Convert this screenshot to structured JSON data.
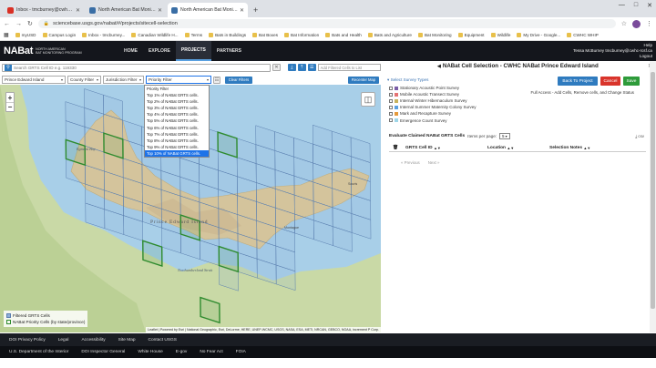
{
  "browser": {
    "tabs": [
      {
        "label": "Inbox - tmcburney@cwhc-rcsf.ca",
        "active": false,
        "color": "#d93025"
      },
      {
        "label": "North American Bat Monitoring",
        "active": false,
        "color": "#3a6ea5"
      },
      {
        "label": "North American Bat Monitoring",
        "active": true,
        "color": "#3a6ea5"
      }
    ],
    "new_tab": "+",
    "url": "sciencebase.usgs.gov/nabat/#/projects/sitecell-selection",
    "bookmarks": [
      "myUSD",
      "Campus Login",
      "Inbox - tmcburney...",
      "Canadian Wildlife H...",
      "Terms",
      "Bats in Buildings",
      "Bat Boxes",
      "Bat Information",
      "Bats and Health",
      "Bats and Agriculture",
      "Bat Monitoring",
      "Equipment",
      "Wildlife",
      "My Drive - Google...",
      "CWHC WHIP"
    ]
  },
  "app": {
    "logo": "NABat",
    "logo_sub_1": "North American",
    "logo_sub_2": "Bat Monitoring Program",
    "nav": [
      "HOME",
      "EXPLORE",
      "PROJECTS",
      "PARTNERS"
    ],
    "active_nav": "PROJECTS",
    "help": "Help",
    "user": "Tessa McBurney tmcburney@cwhc-rcsf.ca",
    "logout": "Logout"
  },
  "tools": {
    "search_placeholder": "Search GRTS Cell ID e.g. 119330",
    "add_cells_placeholder": "Add Filtered Cells to List",
    "province": "Prince Edward Island",
    "county": "County Filter",
    "jurisdiction": "Jurisdiction Filter",
    "priority": "Priority Filter",
    "clear_btn": "Clear Filters",
    "recenter_btn": "Recenter Map",
    "priority_options": [
      "Priority Filter",
      "Top 1% of NABat GRTS cells.",
      "Top 2% of NABat GRTS cells.",
      "Top 3% of NABat GRTS cells.",
      "Top 4% of NABat GRTS cells.",
      "Top 5% of NABat GRTS cells.",
      "Top 6% of NABat GRTS cells.",
      "Top 7% of NABat GRTS cells.",
      "Top 8% of NABat GRTS cells.",
      "Top 9% of NABat GRTS cells.",
      "Top 10% of NABat GRTS cells."
    ],
    "priority_highlighted": 10
  },
  "map": {
    "labels": [
      "Prince Edward Island",
      "Egmont Bay",
      "Northumberland Strait",
      "Montague",
      "Souris"
    ],
    "legend": [
      {
        "label": "Filtered GRTS Cells",
        "color": "#8fb0d8"
      },
      {
        "label": "NABat Priority Cells (by state/province)",
        "color": "#2e8b2e"
      }
    ],
    "attribution": "Leaflet | Powered by Esri | National Geographic, Esri, DeLorme, HERE, UNEP-WCMC, USGS, NASA, ESA, METI, NRCAN, GEBCO, NOAA, increment P Corp."
  },
  "panel": {
    "title": "NABat Cell Selection - CWHC NABat Prince Edward Island",
    "back_btn": "Back To Project",
    "cancel_btn": "Cancel",
    "save_btn": "Save",
    "access": "Full Access - Add Cells, Remove cells, and Change Status",
    "survey_header": "Select Survey Types",
    "survey_types": [
      {
        "label": "Stationary Acoustic Point Survey",
        "color": "#7b5ea7"
      },
      {
        "label": "Mobile Acoustic Transect Survey",
        "color": "#e57373"
      },
      {
        "label": "Internal Winter Hibernaculum Survey",
        "color": "#c7b35e"
      },
      {
        "label": "Internal Summer Maternity Colony Survey",
        "color": "#5aa0e0"
      },
      {
        "label": "Mark and Recapture Survey",
        "color": "#e59a3c"
      },
      {
        "label": "Emergence Count Survey",
        "color": "#9fd6e8"
      }
    ],
    "eval_label": "Evaluate Claimed NABat GRTS Cells",
    "items_per_page": "Items per page:",
    "ipp_value": "5",
    "csv": "csv",
    "col_cell": "GRTS Cell ID",
    "col_location": "Location",
    "col_notes": "Selection Notes",
    "previous": "« Previous",
    "next": "Next »"
  },
  "footer": {
    "row1": [
      "DOI Privacy Policy",
      "Legal",
      "Accessibility",
      "Site Map",
      "Contact USGS"
    ],
    "row2": [
      "U.S. Department of the Interior",
      "DOI Inspector General",
      "White House",
      "E-gov",
      "No Fear Act",
      "FOIA"
    ]
  }
}
